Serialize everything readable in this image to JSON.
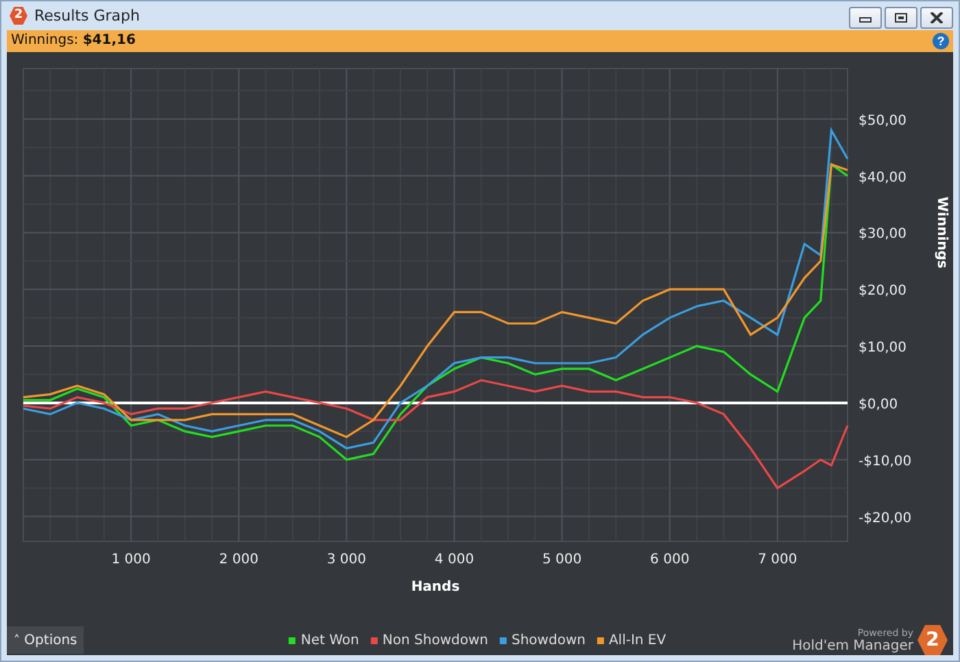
{
  "window": {
    "title": "Results Graph",
    "logo": "2"
  },
  "summary": {
    "label": "Winnings:",
    "value": "$41,16",
    "help": "?"
  },
  "chart": {
    "chart_data": {
      "type": "line",
      "xlabel": "Hands",
      "ylabel": "Winnings",
      "x": [
        0,
        250,
        500,
        750,
        1000,
        1250,
        1500,
        1750,
        2000,
        2250,
        2500,
        2750,
        3000,
        3250,
        3500,
        3750,
        4000,
        4250,
        4500,
        4750,
        5000,
        5250,
        5500,
        5750,
        6000,
        6250,
        6500,
        6750,
        7000,
        7250,
        7400,
        7500,
        7650
      ],
      "series": [
        {
          "name": "Net Won",
          "color": "#22dd22",
          "values": [
            0.5,
            0.5,
            2.5,
            1,
            -4,
            -3,
            -5,
            -6,
            -5,
            -4,
            -4,
            -6,
            -10,
            -9,
            -2,
            3,
            6,
            8,
            7,
            5,
            6,
            6,
            4,
            6,
            8,
            10,
            9,
            5,
            2,
            15,
            18,
            42,
            40
          ]
        },
        {
          "name": "Non Showdown",
          "color": "#e84848",
          "values": [
            -0.5,
            -1,
            1,
            0,
            -2,
            -1,
            -1,
            0,
            1,
            2,
            1,
            0,
            -1,
            -3,
            -3,
            1,
            2,
            4,
            3,
            2,
            3,
            2,
            2,
            1,
            1,
            0,
            -2,
            -8,
            -15,
            -12,
            -10,
            -11,
            -4
          ]
        },
        {
          "name": "Showdown",
          "color": "#3a9ee0",
          "values": [
            -1,
            -2,
            0,
            -1,
            -3,
            -2,
            -4,
            -5,
            -4,
            -3,
            -3,
            -5,
            -8,
            -7,
            0,
            3,
            7,
            8,
            8,
            7,
            7,
            7,
            8,
            12,
            15,
            17,
            18,
            15,
            12,
            28,
            26,
            48,
            43
          ]
        },
        {
          "name": "All-In EV",
          "color": "#f0962e",
          "values": [
            1,
            1.5,
            3,
            1.5,
            -3,
            -3,
            -3,
            -2,
            -2,
            -2,
            -2,
            -4,
            -6,
            -3,
            3,
            10,
            16,
            16,
            14,
            14,
            16,
            15,
            14,
            18,
            20,
            20,
            20,
            12,
            15,
            22,
            25,
            42,
            41
          ]
        }
      ],
      "grid": true,
      "xlim": [
        0,
        7650
      ],
      "ylim": [
        -24.4,
        58.9
      ],
      "xticks": [
        {
          "value": 1000,
          "label": "1 000"
        },
        {
          "value": 2000,
          "label": "2 000"
        },
        {
          "value": 3000,
          "label": "3 000"
        },
        {
          "value": 4000,
          "label": "4 000"
        },
        {
          "value": 5000,
          "label": "5 000"
        },
        {
          "value": 6000,
          "label": "6 000"
        },
        {
          "value": 7000,
          "label": "7 000"
        }
      ],
      "yticks": [
        {
          "value": -20,
          "label": "-$20,00"
        },
        {
          "value": -10,
          "label": "-$10,00"
        },
        {
          "value": 0,
          "label": "$0,00"
        },
        {
          "value": 10,
          "label": "$10,00"
        },
        {
          "value": 20,
          "label": "$20,00"
        },
        {
          "value": 30,
          "label": "$30,00"
        },
        {
          "value": 40,
          "label": "$40,00"
        },
        {
          "value": 50,
          "label": "$50,00"
        }
      ]
    }
  },
  "footer": {
    "options_button": "Options",
    "options_caret": "˄",
    "powered_by": "Powered by",
    "brand": "Hold'em Manager",
    "logo": "2"
  }
}
